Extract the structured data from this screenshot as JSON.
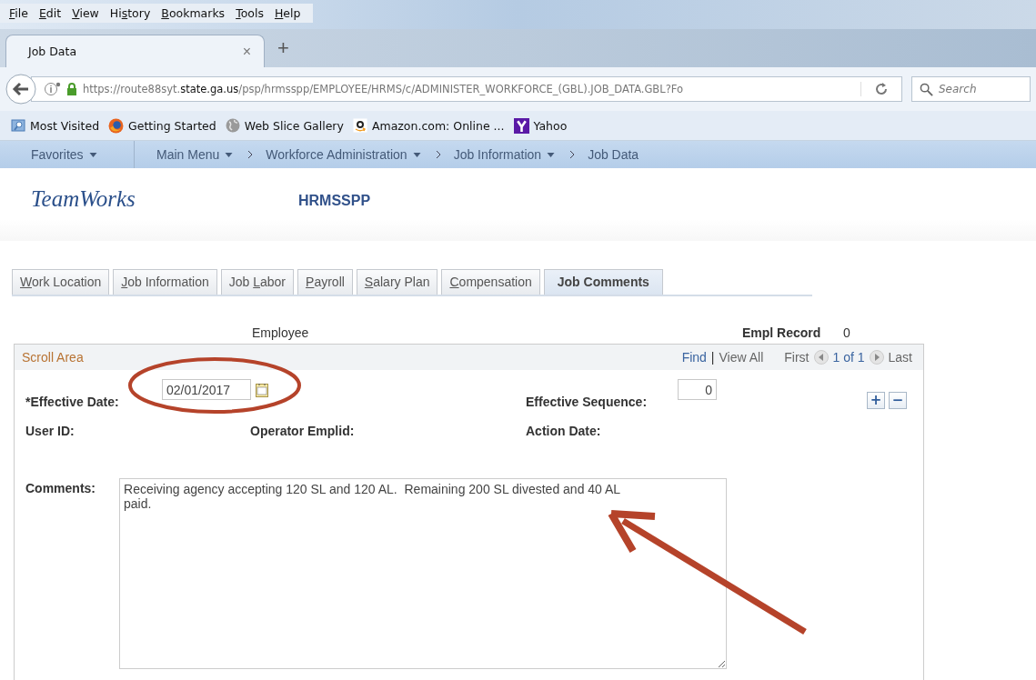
{
  "menu_bar": [
    {
      "key": "F",
      "post": "ile"
    },
    {
      "key": "E",
      "post": "dit"
    },
    {
      "key": "V",
      "post": "iew"
    },
    {
      "pre": "Hi",
      "key": "s",
      "post": "tory"
    },
    {
      "key": "B",
      "post": "ookmarks"
    },
    {
      "key": "T",
      "post": "ools"
    },
    {
      "key": "H",
      "post": "elp"
    }
  ],
  "browser_tabs": [
    {
      "title": "Job Data",
      "selected": true,
      "close": "×"
    }
  ],
  "new_tab": "+",
  "address": {
    "url": "https://route88syt.**state.ga.us**/psp/hrmsspp/EMPLOYEE/HRMS/c/ADMINISTER_WORKFORCE_(GBL).JOB_DATA.GBL?Fo"
  },
  "search": {
    "placeholder": "Search"
  },
  "bookmarks": [
    {
      "label": "Most Visited",
      "kind": "folder"
    },
    {
      "label": "Getting Started",
      "kind": "firefox"
    },
    {
      "label": "Web Slice Gallery",
      "kind": "globe"
    },
    {
      "label": "Amazon.com: Online ...",
      "kind": "amazon"
    },
    {
      "label": "Yahoo",
      "kind": "yahoo"
    }
  ],
  "breadcrumbs": [
    {
      "label": "Favorites",
      "dropdown": true,
      "chevron": false
    },
    {
      "label": "Main Menu",
      "dropdown": true,
      "chevron": false
    },
    {
      "label": "Workforce Administration",
      "dropdown": true,
      "chevron": true
    },
    {
      "label": "Job Information",
      "dropdown": true,
      "chevron": true
    },
    {
      "label": "Job Data",
      "dropdown": false,
      "chevron": true
    }
  ],
  "header": {
    "logo": "TeamWorks",
    "database": "HRMSSPP"
  },
  "page_tabs": [
    {
      "key": "W",
      "post": "ork Location",
      "selected": false
    },
    {
      "key": "J",
      "post": "ob Information",
      "selected": false
    },
    {
      "pre": "Job ",
      "key": "L",
      "post": "abor",
      "selected": false
    },
    {
      "key": "P",
      "post": "ayroll",
      "selected": false
    },
    {
      "key": "S",
      "post": "alary Plan",
      "selected": false
    },
    {
      "key": "C",
      "post": "ompensation",
      "selected": false
    },
    {
      "pre": "Job Comments",
      "selected": true
    }
  ],
  "employee_label": "Employee",
  "empl_record": {
    "label": "Empl Record",
    "value": "0"
  },
  "scroll_area": {
    "title": "Scroll Area",
    "find": "Find",
    "separator": "|",
    "view_all": "View All",
    "first": "First",
    "count": "1 of 1",
    "last": "Last",
    "add": "+",
    "remove": "−"
  },
  "fields": {
    "effective_date": {
      "label": "*Effective Date:",
      "value": "02/01/2017"
    },
    "effective_sequence": {
      "label": "Effective Sequence:",
      "value": "0"
    },
    "user_id": {
      "label": "User ID:"
    },
    "operator_emplid": {
      "label": "Operator Emplid:"
    },
    "action_date": {
      "label": "Action Date:"
    },
    "comments": {
      "label": "Comments:",
      "value": "Receiving agency accepting 120 SL and 120 AL.  Remaining 200 SL divested and 40 AL paid. "
    }
  }
}
